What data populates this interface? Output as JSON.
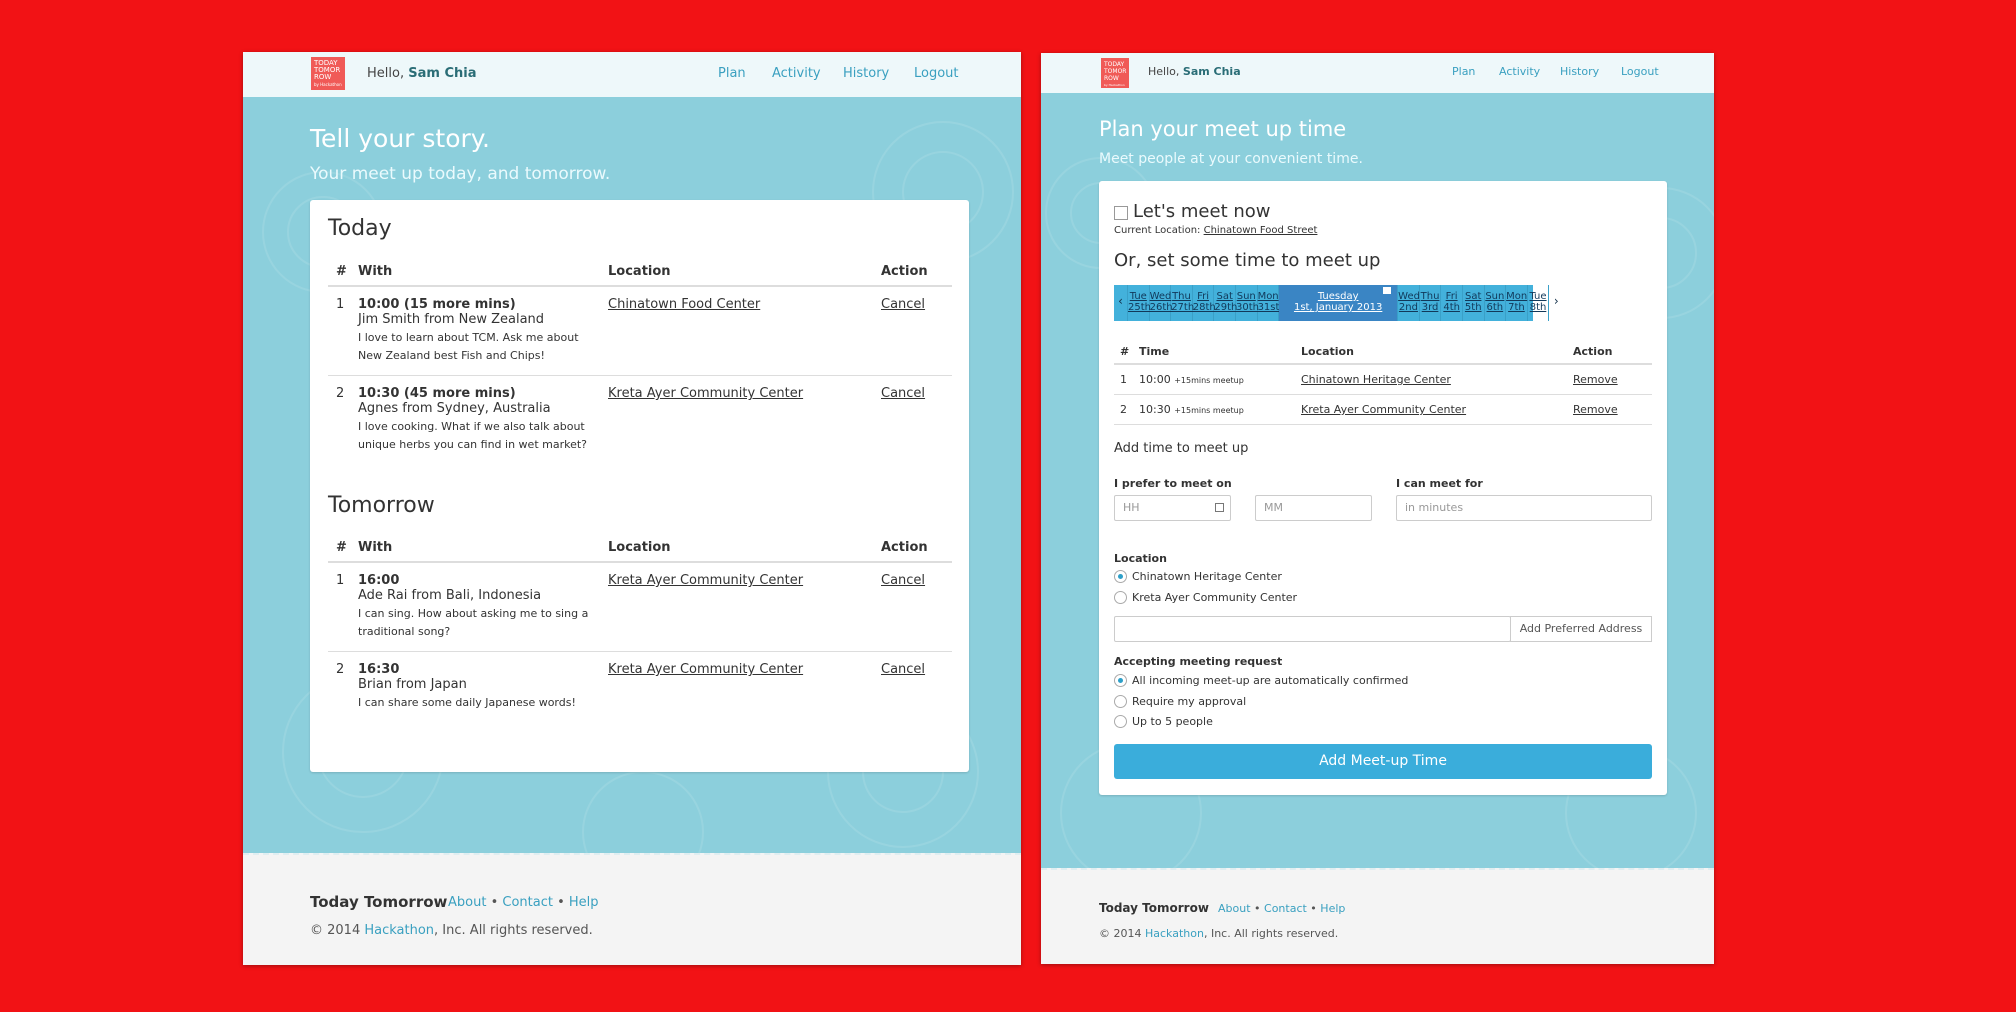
{
  "left": {
    "logo": [
      "TODAY",
      "TOMOR",
      "ROW",
      "by Hackathon"
    ],
    "hello_prefix": "Hello,",
    "user": "Sam Chia",
    "nav": [
      "Plan",
      "Activity",
      "History",
      "Logout"
    ],
    "title": "Tell your story.",
    "subtitle": "Your meet up today, and tomorrow.",
    "columns": [
      "#",
      "With",
      "Location",
      "Action"
    ],
    "today_heading": "Today",
    "today": [
      {
        "num": "1",
        "time": "10:00 (15 more mins)",
        "person": "Jim Smith from New Zealand",
        "note": "I love to learn about TCM. Ask me about New Zealand best Fish and Chips!",
        "location": "Chinatown Food Center",
        "action": "Cancel"
      },
      {
        "num": "2",
        "time": "10:30 (45 more mins)",
        "person": "Agnes from Sydney, Australia",
        "note": "I love cooking. What if we also talk about unique herbs you can find in wet market?",
        "location": "Kreta Ayer Community Center",
        "action": "Cancel"
      }
    ],
    "tomorrow_heading": "Tomorrow",
    "tomorrow": [
      {
        "num": "1",
        "time": "16:00",
        "person": "Ade Rai from Bali, Indonesia",
        "note": "I can sing. How about asking me to sing a traditional song?",
        "location": "Kreta Ayer Community Center",
        "action": "Cancel"
      },
      {
        "num": "2",
        "time": "16:30",
        "person": "Brian from Japan",
        "note": "I can share some daily Japanese words!",
        "location": "Kreta Ayer Community Center",
        "action": "Cancel"
      }
    ],
    "footer": {
      "brand": "Today Tomorrow",
      "links": [
        "About",
        "Contact",
        "Help"
      ],
      "copy_prefix": "© 2014",
      "copy_link": "Hackathon",
      "copy_suffix": ", Inc. All rights reserved."
    }
  },
  "right": {
    "logo": [
      "TODAY",
      "TOMOR",
      "ROW",
      "by Hackathon"
    ],
    "hello_prefix": "Hello,",
    "user": "Sam Chia",
    "nav": [
      "Plan",
      "Activity",
      "History",
      "Logout"
    ],
    "title": "Plan your meet up time",
    "subtitle": "Meet people at your convenient time.",
    "meet_now": "Let's meet now",
    "current_location_label": "Current Location:",
    "current_location": "Chinatown Food Street",
    "set_time_heading": "Or, set some time to meet up",
    "dates": [
      {
        "day": "Tue",
        "date": "25th"
      },
      {
        "day": "Wed",
        "date": "26th"
      },
      {
        "day": "Thu",
        "date": "27th"
      },
      {
        "day": "Fri",
        "date": "28th"
      },
      {
        "day": "Sat",
        "date": "29th"
      },
      {
        "day": "Sun",
        "date": "30th"
      },
      {
        "day": "Mon",
        "date": "31st"
      },
      {
        "day": "Tuesday",
        "date": "1st, January 2013",
        "active": true
      },
      {
        "day": "Wed",
        "date": "2nd"
      },
      {
        "day": "Thu",
        "date": "3rd"
      },
      {
        "day": "Fri",
        "date": "4th"
      },
      {
        "day": "Sat",
        "date": "5th"
      },
      {
        "day": "Sun",
        "date": "6th"
      },
      {
        "day": "Mon",
        "date": "7th"
      },
      {
        "day": "Tue",
        "date": "8th"
      }
    ],
    "columns": [
      "#",
      "Time",
      "Location",
      "Action"
    ],
    "rows": [
      {
        "num": "1",
        "time": "10:00",
        "duration": "+15mins meetup",
        "location": "Chinatown Heritage Center",
        "action": "Remove"
      },
      {
        "num": "2",
        "time": "10:30",
        "duration": "+15mins meetup",
        "location": "Kreta Ayer Community Center",
        "action": "Remove"
      }
    ],
    "add_time_label": "Add time to meet up",
    "prefer_label": "I prefer to meet on",
    "meet_for_label": "I can meet for",
    "hh_placeholder": "HH",
    "mm_placeholder": "MM",
    "minutes_placeholder": "in minutes",
    "location_label": "Location",
    "location_options": [
      "Chinatown Heritage Center",
      "Kreta Ayer Community Center"
    ],
    "add_address_button": "Add Preferred Address",
    "accepting_label": "Accepting meeting request",
    "accepting_options": [
      "All incoming meet-up are automatically confirmed",
      "Require my approval",
      "Up to 5 people"
    ],
    "submit_button": "Add Meet-up Time",
    "footer": {
      "brand": "Today Tomorrow",
      "links": [
        "About",
        "Contact",
        "Help"
      ],
      "copy_prefix": "© 2014",
      "copy_link": "Hackathon",
      "copy_suffix": ", Inc. All rights reserved."
    }
  },
  "colors": {
    "background": "#f21215",
    "panel": "#8ccfdc",
    "accent": "#3aaddb",
    "logo": "#f05a57"
  }
}
